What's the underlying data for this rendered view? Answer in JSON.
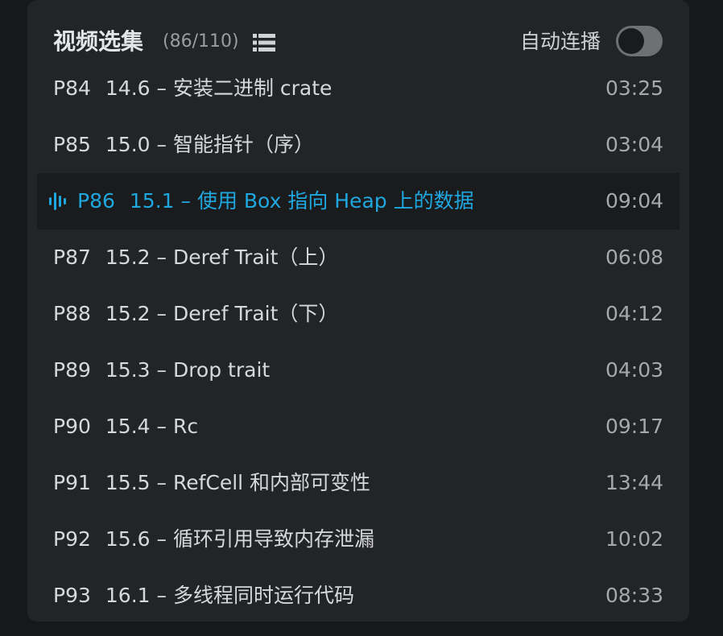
{
  "header": {
    "title": "视频选集",
    "count": "(86/110)",
    "autoplay_label": "自动连播",
    "autoplay_on": false,
    "list_icon": "list-icon"
  },
  "colors": {
    "active": "#1fa7e0",
    "panel_bg": "#232426",
    "active_bg": "#1a1b1d"
  },
  "episodes": [
    {
      "ep": "P84",
      "title": "14.6 – 安装二进制 crate",
      "duration": "03:25",
      "active": false
    },
    {
      "ep": "P85",
      "title": "15.0 – 智能指针（序）",
      "duration": "03:04",
      "active": false
    },
    {
      "ep": "P86",
      "title": "15.1 – 使用 Box 指向 Heap 上的数据",
      "duration": "09:04",
      "active": true
    },
    {
      "ep": "P87",
      "title": "15.2 – Deref Trait（上）",
      "duration": "06:08",
      "active": false
    },
    {
      "ep": "P88",
      "title": "15.2 – Deref Trait（下）",
      "duration": "04:12",
      "active": false
    },
    {
      "ep": "P89",
      "title": "15.3 – Drop trait",
      "duration": "04:03",
      "active": false
    },
    {
      "ep": "P90",
      "title": "15.4 – Rc",
      "duration": "09:17",
      "active": false
    },
    {
      "ep": "P91",
      "title": "15.5 – RefCell 和内部可变性",
      "duration": "13:44",
      "active": false
    },
    {
      "ep": "P92",
      "title": "15.6 – 循环引用导致内存泄漏",
      "duration": "10:02",
      "active": false
    },
    {
      "ep": "P93",
      "title": "16.1 – 多线程同时运行代码",
      "duration": "08:33",
      "active": false
    }
  ]
}
